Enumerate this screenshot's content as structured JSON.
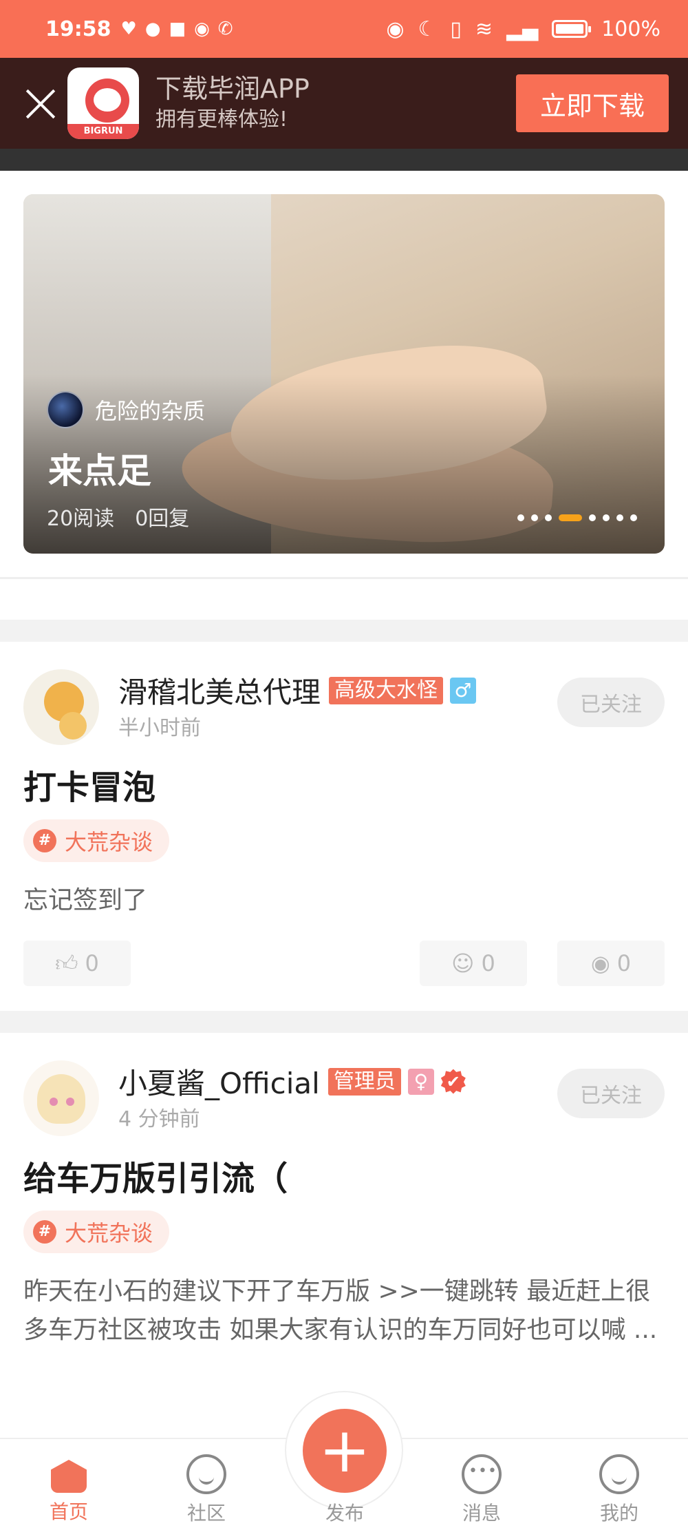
{
  "status_bar": {
    "time": "19:58",
    "battery": "100%"
  },
  "download_banner": {
    "title": "下载毕润APP",
    "subtitle": "拥有更棒体验!",
    "logo_text": "BIGRUN",
    "button": "立即下载"
  },
  "hero": {
    "author": "危险的杂质",
    "title": "来点足",
    "reads": "20阅读",
    "replies": "0回复",
    "slide_count": 8,
    "active_slide": 4
  },
  "posts": [
    {
      "user": "滑稽北美总代理",
      "level": "高级大水怪",
      "gender_symbol": "♂",
      "time": "半小时前",
      "follow": "已关注",
      "title": "打卡冒泡",
      "topic": "大荒杂谈",
      "topic_icon": "#",
      "excerpt": "忘记签到了",
      "likes": "0",
      "comments": "0",
      "views": "0"
    },
    {
      "user": "小夏酱_Official",
      "level": "管理员",
      "gender_symbol": "♀",
      "time": "4 分钟前",
      "follow": "已关注",
      "title": "给车万版引引流（",
      "topic": "大荒杂谈",
      "topic_icon": "#",
      "excerpt": "昨天在小石的建议下开了车万版 >>一键跳转 最近赶上很多车万社区被攻击 如果大家有认识的车万同好也可以喊 ..."
    }
  ],
  "bottom_nav": {
    "home": "首页",
    "community": "社区",
    "publish": "发布",
    "messages": "消息",
    "mine": "我的"
  }
}
